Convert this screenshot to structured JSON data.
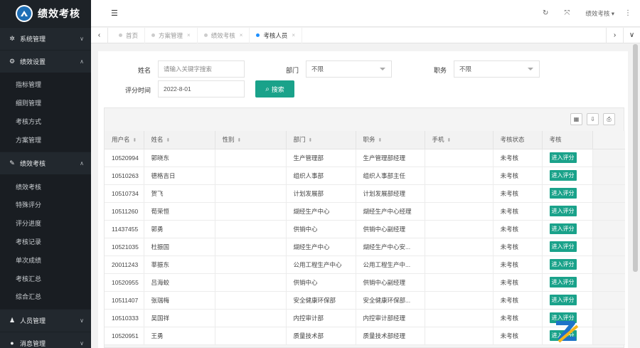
{
  "app": {
    "title": "绩效考核"
  },
  "sidebar": {
    "groups": [
      {
        "label": "系统管理",
        "icon": "gear-icon",
        "glyph": "✲",
        "chevron": "∨",
        "items": []
      },
      {
        "label": "绩效设置",
        "icon": "gears-icon",
        "glyph": "⚙",
        "chevron": "∧",
        "items": [
          "指标管理",
          "细则管理",
          "考核方式",
          "方案管理"
        ]
      },
      {
        "label": "绩效考核",
        "icon": "edit-icon",
        "glyph": "✎",
        "chevron": "∧",
        "items": [
          "绩效考核",
          "特殊评分",
          "评分进度",
          "考核记录",
          "单次成绩",
          "考核汇总",
          "综合汇总"
        ]
      },
      {
        "label": "人员管理",
        "icon": "user-icon",
        "glyph": "♟",
        "chevron": "∨",
        "items": []
      },
      {
        "label": "消息管理",
        "icon": "message-icon",
        "glyph": "●",
        "chevron": "∨",
        "items": []
      }
    ]
  },
  "header": {
    "menu_glyph": "☰",
    "refresh_glyph": "↻",
    "fullscreen_glyph": "⤧",
    "user_label": "绩效考核 ▾",
    "more_glyph": "⋮"
  },
  "tabs": {
    "left_arrow": "‹",
    "right_arrow": "›",
    "down_arrow": "∨",
    "close_glyph": "×",
    "items": [
      {
        "label": "首页",
        "closable": false,
        "active": false
      },
      {
        "label": "方案管理",
        "closable": true,
        "active": false
      },
      {
        "label": "绩效考核",
        "closable": true,
        "active": false
      },
      {
        "label": "考核人员",
        "closable": true,
        "active": true
      }
    ]
  },
  "filters": {
    "name_label": "姓名",
    "name_placeholder": "请输入关键字搜索",
    "dept_label": "部门",
    "dept_value": "不限",
    "position_label": "职务",
    "position_value": "不限",
    "date_label": "评分时间",
    "date_value": "2022-8-01",
    "search_label": "搜索",
    "search_glyph": "🔍"
  },
  "toolbar": {
    "columns_glyph": "▦",
    "export_glyph": "⇩",
    "print_glyph": "⎙"
  },
  "table": {
    "sort_glyph": "⬍",
    "columns": [
      "用户名",
      "姓名",
      "性别",
      "部门",
      "职务",
      "手机",
      "考核状态",
      "考核"
    ],
    "sortable": [
      true,
      true,
      true,
      true,
      true,
      true,
      false,
      false
    ],
    "action_label": "进入评分",
    "rows": [
      [
        "10520994",
        "郭晓东",
        "",
        "生产管理部",
        "生产管理部经理",
        "",
        "未考核"
      ],
      [
        "10510263",
        "德格吉日",
        "",
        "组织人事部",
        "组织人事部主任",
        "",
        "未考核"
      ],
      [
        "10510734",
        "贺飞",
        "",
        "计划发展部",
        "计划发展部经理",
        "",
        "未考核"
      ],
      [
        "10511260",
        "荀荣恒",
        "",
        "煳经生产中心",
        "煳经生产中心经理",
        "",
        "未考核"
      ],
      [
        "11437455",
        "郭勇",
        "",
        "供销中心",
        "供销中心副经理",
        "",
        "未考核"
      ],
      [
        "10521035",
        "杜振国",
        "",
        "煳经生产中心",
        "煳经生产中心安...",
        "",
        "未考核"
      ],
      [
        "20011243",
        "莘振东",
        "",
        "公用工程生产中心",
        "公用工程生产中...",
        "",
        "未考核"
      ],
      [
        "10520955",
        "吕海蛟",
        "",
        "供销中心",
        "供销中心副经理",
        "",
        "未考核"
      ],
      [
        "10511407",
        "张瑞梅",
        "",
        "安全健康环保部",
        "安全健康环保部...",
        "",
        "未考核"
      ],
      [
        "10510333",
        "吴国祥",
        "",
        "内控审计部",
        "内控审计部经理",
        "",
        "未考核"
      ],
      [
        "10520951",
        "王勇",
        "",
        "质量技术部",
        "质量技术部经理",
        "",
        "未考核"
      ]
    ]
  },
  "colors": {
    "accent": "#1aa28a",
    "sidebar_bg": "#22282e",
    "active_tab_dot": "#1e90ff"
  }
}
